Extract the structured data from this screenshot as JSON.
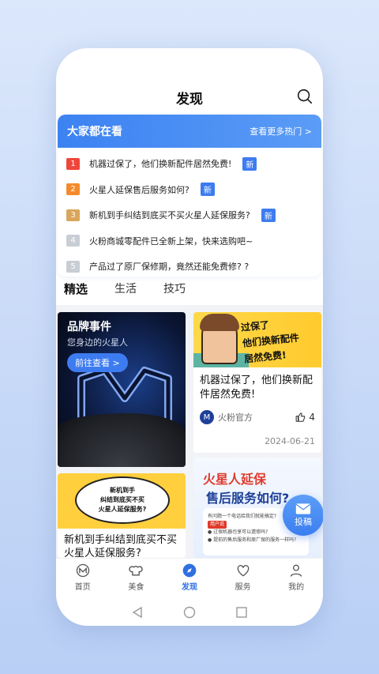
{
  "header": {
    "title": "发现"
  },
  "hot": {
    "title": "大家都在看",
    "more": "查看更多热门 >",
    "items": [
      {
        "rank": "1",
        "text": "机器过保了，他们换新配件居然免费!",
        "tag": "新",
        "color": "#f0453a"
      },
      {
        "rank": "2",
        "text": "火星人延保售后服务如何?",
        "tag": "新",
        "color": "#f58a2c"
      },
      {
        "rank": "3",
        "text": "新机到手纠结到底买不买火星人延保服务?",
        "tag": "新",
        "color": "#d9a65a"
      },
      {
        "rank": "4",
        "text": "火粉商城零配件已全新上架，快来选购吧~",
        "tag": "",
        "color": "#c9cdd4"
      },
      {
        "rank": "5",
        "text": "产品过了原厂保修期，竟然还能免费修? ?",
        "tag": "",
        "color": "#c9cdd4"
      }
    ]
  },
  "tabs": [
    "精选",
    "生活",
    "技巧"
  ],
  "brand_card": {
    "title": "品牌事件",
    "subtitle": "您身边的火星人",
    "button": "前往查看 >"
  },
  "card1": {
    "cover_text": [
      "过保了",
      "他们换新配件",
      "居然免费!"
    ],
    "title": "机器过保了，他们换新配件居然免费!",
    "author": "火粉官方",
    "likes": "4",
    "date": "2024-06-21"
  },
  "card2": {
    "cover_lines": [
      "新机到手",
      "纠结到底买不买",
      "火星人延保服务?"
    ],
    "title": "新机到手纠结到底买不买火星人延保服务?"
  },
  "card3": {
    "title1": "火星人延保",
    "title2": "售后服务如何?",
    "line1": "有问题一个电话给我们就能搞定?",
    "tag": "用户说",
    "line2": "● 过保机器也享可以遗修吗?",
    "line3": "● 提前的售后服务和原厂保的服务一样吗?"
  },
  "fab": {
    "label": "投稿"
  },
  "nav": [
    {
      "label": "首页",
      "active": false
    },
    {
      "label": "美食",
      "active": false
    },
    {
      "label": "发现",
      "active": true
    },
    {
      "label": "服务",
      "active": false
    },
    {
      "label": "我的",
      "active": false
    }
  ]
}
